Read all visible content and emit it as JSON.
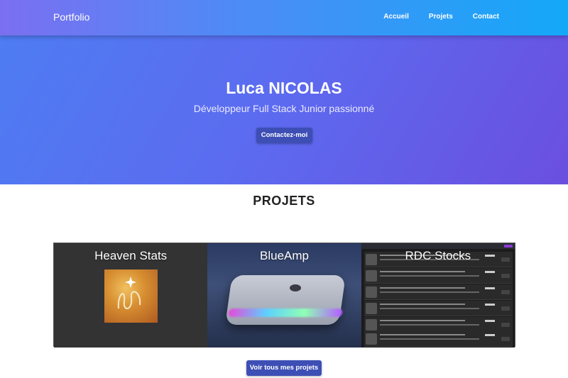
{
  "navbar": {
    "brand": "Portfolio",
    "links": [
      "Accueil",
      "Projets",
      "Contact"
    ]
  },
  "hero": {
    "title": "Luca NICOLAS",
    "subtitle": "Développeur Full Stack Junior passionné",
    "cta_label": "Contactez-moi"
  },
  "projects": {
    "section_title": "PROJETS",
    "cards": [
      {
        "title": "Heaven Stats",
        "icon": "heaven-stats-logo"
      },
      {
        "title": "BlueAmp",
        "icon": "blueamp-device-image"
      },
      {
        "title": "RDC Stocks",
        "icon": "rdc-stocks-screenshot"
      }
    ],
    "view_all_label": "Voir tous mes projets"
  },
  "colors": {
    "navbar_start": "#7b6ff0",
    "navbar_end": "#14a8f8",
    "hero_start": "#4e7cf2",
    "hero_end": "#6b4fe0",
    "button": "#3d4fb5"
  }
}
